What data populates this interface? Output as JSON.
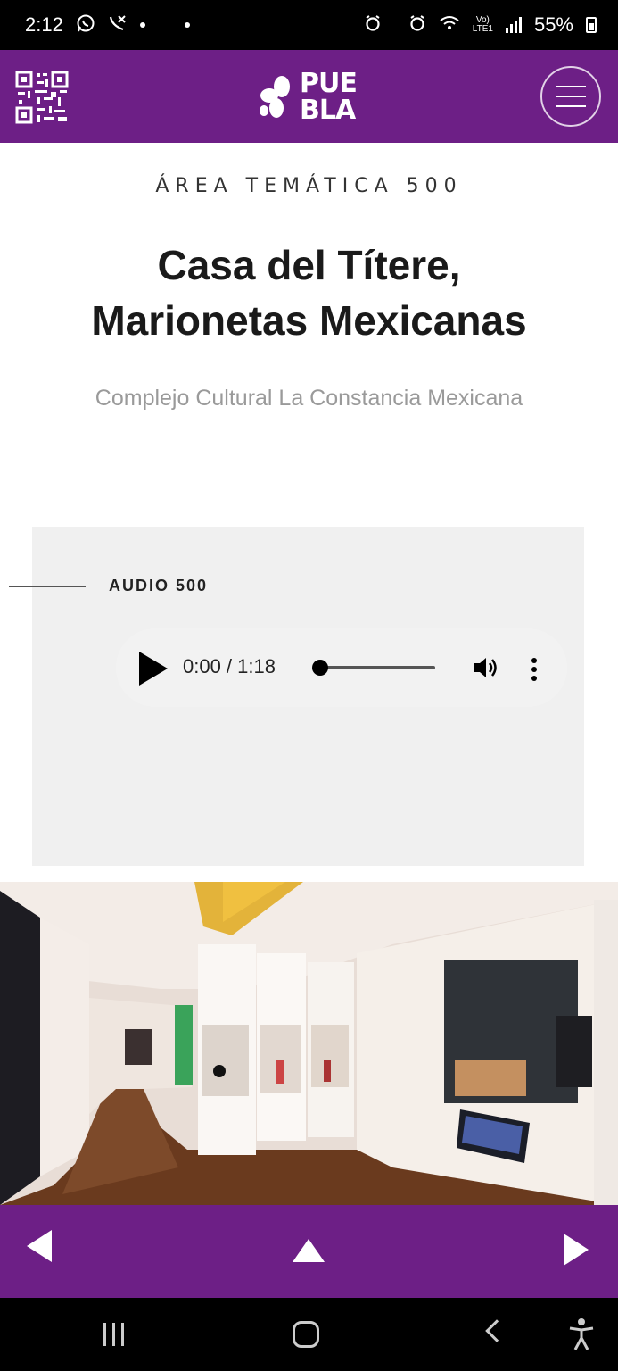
{
  "status_bar": {
    "time": "2:12",
    "battery": "55%",
    "icons": [
      "whatsapp-icon",
      "missed-call-icon",
      "alarm-icon",
      "wifi-icon",
      "lte-icon",
      "signal-icon",
      "battery-icon"
    ]
  },
  "header": {
    "logo_line1": "PUE",
    "logo_line2": "BLA",
    "brand_color": "#6d1f86"
  },
  "content": {
    "kicker": "ÁREA TEMÁTICA 500",
    "title_line1": "Casa del Títere,",
    "title_line2": "Marionetas Mexicanas",
    "subtitle": "Complejo Cultural La Constancia Mexicana"
  },
  "audio": {
    "label": "AUDIO 500",
    "time": "0:00 / 1:18",
    "progress": 0
  },
  "gallery": {
    "image": "museum-hallway-photo"
  },
  "bottom_nav": {
    "icons": [
      "prev-arrow-icon",
      "up-arrow-icon",
      "next-arrow-icon"
    ]
  },
  "android_nav": {
    "icons": [
      "recent-apps-icon",
      "home-icon",
      "back-icon",
      "accessibility-icon"
    ]
  }
}
